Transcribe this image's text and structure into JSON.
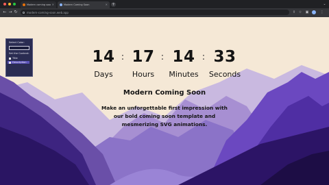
{
  "browser": {
    "tabs": [
      {
        "title": "Modern coming soon – Cod",
        "active": false,
        "favicon_color": "#e8710a"
      },
      {
        "title": "Modern Coming Soon",
        "active": true,
        "favicon_color": "#8ab4f8"
      }
    ],
    "new_tab_icon": "plus-icon",
    "url": "modern-coming-soon.web.app"
  },
  "settings": {
    "select_color_label": "Select Color:",
    "set_content_label": "Set the Content:",
    "options": [
      {
        "label": "Title",
        "checked": true,
        "selected": false
      },
      {
        "label": "Description",
        "checked": true,
        "selected": true
      }
    ],
    "color_value": "#1b1d3c"
  },
  "countdown": {
    "days": {
      "value": "14",
      "label": "Days"
    },
    "hours": {
      "value": "17",
      "label": "Hours"
    },
    "minutes": {
      "value": "14",
      "label": "Minutes"
    },
    "seconds": {
      "value": "33",
      "label": "Seconds"
    },
    "separator": ":"
  },
  "content": {
    "title": "Modern Coming Soon",
    "description": "Make an unforgettable first impression with our bold coming soon template and mesmerizing SVG animations."
  },
  "colors": {
    "background": "#f5e8d6",
    "mountain_light": "#b7a8d6",
    "mountain_mid": "#7b5cc4",
    "mountain_dark": "#3a1f7a",
    "mountain_darkest": "#1d0d45"
  }
}
